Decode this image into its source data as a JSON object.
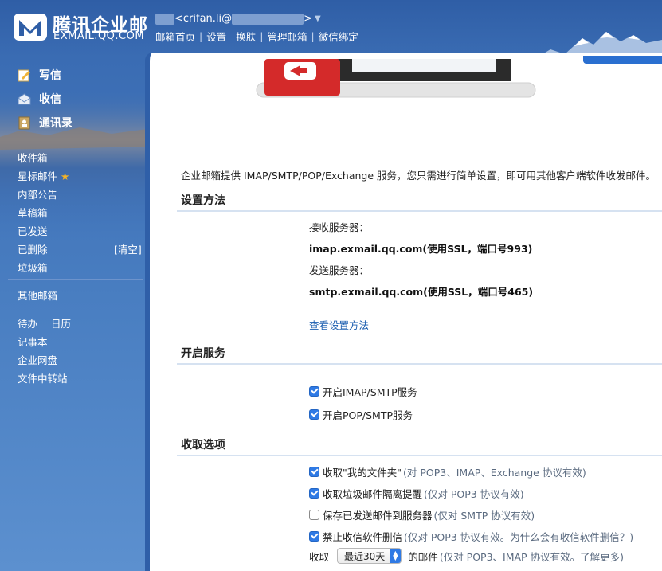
{
  "brand": {
    "name": "腾讯企业邮",
    "sub": "EXMAIL.QQ.COM"
  },
  "user": {
    "email_visible": "<crifan.li@",
    "email_suffix": ">"
  },
  "top_nav": {
    "home": "邮箱首页",
    "settings": "设置",
    "skin": "换肤",
    "manage": "管理邮箱",
    "wechat": "微信绑定"
  },
  "sidebar": {
    "compose": "写信",
    "inbox_action": "收信",
    "contacts": "通讯录",
    "folders": [
      "收件箱",
      "星标邮件",
      "内部公告",
      "草稿箱",
      "已发送",
      "已删除",
      "垃圾箱"
    ],
    "clear": "[清空]",
    "other_mailbox": "其他邮箱",
    "tools": {
      "todo": "待办",
      "calendar": "日历",
      "notes": "记事本",
      "disk": "企业网盘",
      "transfer": "文件中转站"
    }
  },
  "content": {
    "intro": "企业邮箱提供 IMAP/SMTP/POP/Exchange 服务，您只需进行简单设置，即可用其他客户端软件收发邮件。",
    "setup": {
      "title": "设置方法",
      "recv_label": "接收服务器：",
      "recv_value": "imap.exmail.qq.com(使用SSL，端口号993)",
      "send_label": "发送服务器：",
      "send_value": "smtp.exmail.qq.com(使用SSL，端口号465)",
      "view_link": "查看设置方法"
    },
    "service": {
      "title": "开启服务",
      "options": [
        {
          "label": "开启IMAP/SMTP服务",
          "checked": true
        },
        {
          "label": "开启POP/SMTP服务",
          "checked": true
        }
      ]
    },
    "receive": {
      "title": "收取选项",
      "options": [
        {
          "label": "收取\"我的文件夹\"",
          "note": "(对 POP3、IMAP、Exchange 协议有效)",
          "checked": true
        },
        {
          "label": "收取垃圾邮件隔离提醒",
          "note": "(仅对 POP3 协议有效)",
          "checked": true
        },
        {
          "label": "保存已发送邮件到服务器",
          "note": "(仅对 SMTP 协议有效)",
          "checked": false
        },
        {
          "label": "禁止收信软件删信",
          "note": "(仅对 POP3 协议有效。为什么会有收信软件删信？)",
          "checked": true
        }
      ],
      "range_prefix": "收取",
      "range_value": "最近30天",
      "range_suffix": "的邮件",
      "range_note": "(仅对 POP3、IMAP 协议有效。了解更多)"
    }
  }
}
